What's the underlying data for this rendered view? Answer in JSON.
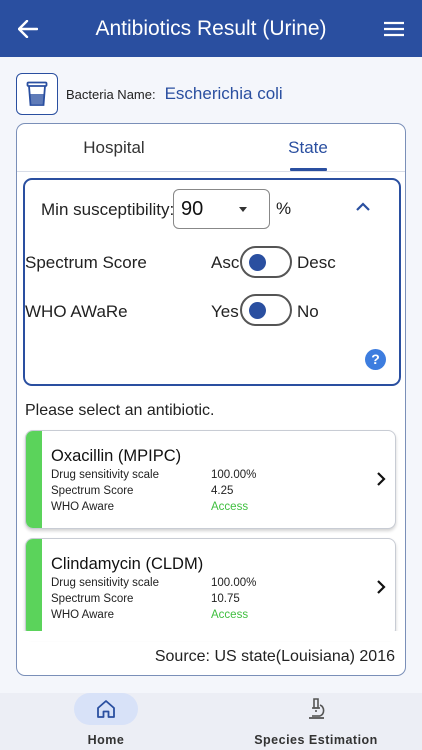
{
  "app_bar": {
    "title": "Antibiotics Result (Urine)",
    "back_icon": "arrow-left-icon",
    "menu_icon": "hamburger-menu-icon"
  },
  "bacteria": {
    "label": "Bacteria Name:",
    "value": "Escherichia coli",
    "icon": "urine-cup-icon"
  },
  "tabs": [
    {
      "label": "Hospital",
      "active": false
    },
    {
      "label": "State",
      "active": true
    }
  ],
  "filters": {
    "min_susceptibility_label": "Min susceptibility:",
    "min_susceptibility_value": "90",
    "percent_sign": "%",
    "spectrum_label": "Spectrum Score",
    "spectrum_left": "Asc",
    "spectrum_right": "Desc",
    "spectrum_selected": "Asc",
    "who_label": "WHO AWaRe",
    "who_left": "Yes",
    "who_right": "No",
    "who_selected": "Yes",
    "help_glyph": "?"
  },
  "prompt": "Please select an antibiotic.",
  "antibiotics": [
    {
      "name": "Oxacillin (MPIPC)",
      "sensitivity_label": "Drug sensitivity scale",
      "sensitivity_value": "100.00%",
      "spectrum_label": "Spectrum Score",
      "spectrum_value": "4.25",
      "who_label": "WHO Aware",
      "who_value": "Access"
    },
    {
      "name": "Clindamycin (CLDM)",
      "sensitivity_label": "Drug sensitivity scale",
      "sensitivity_value": "100.00%",
      "spectrum_label": "Spectrum Score",
      "spectrum_value": "10.75",
      "who_label": "WHO Aware",
      "who_value": "Access"
    }
  ],
  "source": "Source: US state(Louisiana) 2016",
  "bottom_nav": [
    {
      "label": "Home",
      "icon": "home-icon",
      "active": true
    },
    {
      "label": "Species Estimation",
      "icon": "microscope-icon",
      "active": false
    }
  ],
  "colors": {
    "primary": "#2a4fa0",
    "access_green": "#3fbf3f",
    "card_bar_green": "#5bd35b",
    "help_blue": "#3d7ddf"
  }
}
